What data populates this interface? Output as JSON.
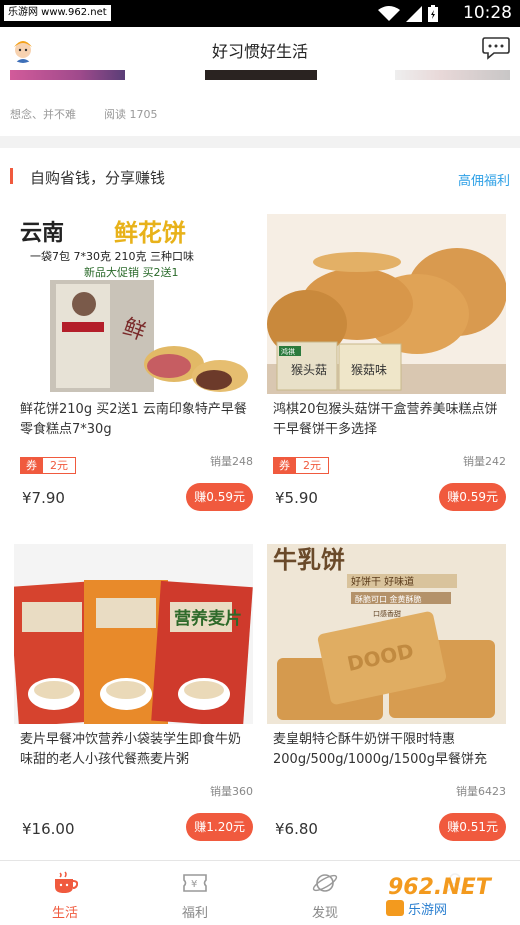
{
  "status_bar": {
    "watermark": "乐游网 www.962.net",
    "time": "10:28"
  },
  "header": {
    "title": "好习惯好生活",
    "avatar_icon": "cartoon-avatar",
    "chat_icon": "chat-bubble-icon"
  },
  "post": {
    "author": "想念、并不难",
    "reads": "阅读 1705"
  },
  "section": {
    "title": "自购省钱，分享赚钱",
    "link": "高佣福利"
  },
  "products": [
    {
      "name": "鲜花饼210g 买2送1 云南印象特产早餐零食糕点7*30g",
      "coupon_tag": "券",
      "coupon_amount": "2元",
      "sales": "销量248",
      "price": "¥7.90",
      "earn": "赚0.59元",
      "image_text": {
        "t1": "云南",
        "t2": "鲜花饼",
        "t3": "一袋7包  7*30克  210克 三种口味",
        "t4": "新品大促销  买2送1"
      }
    },
    {
      "name": "鸿棋20包猴头菇饼干盒营养美味糕点饼干早餐饼干多选择",
      "coupon_tag": "券",
      "coupon_amount": "2元",
      "sales": "销量242",
      "price": "¥5.90",
      "earn": "赚0.59元",
      "image_text": {
        "t1": "鸿祺",
        "t2": "猴头菇",
        "t3": "猴菇味"
      }
    },
    {
      "name": "麦片早餐冲饮营养小袋装学生即食牛奶味甜的老人小孩代餐燕麦片粥",
      "sales": "销量360",
      "price": "¥16.00",
      "earn": "赚1.20元",
      "image_text": {
        "t1": "营养麦片"
      }
    },
    {
      "name": "麦皇朝特仑酥牛奶饼干限时特惠200g/500g/1000g/1500g早餐饼充",
      "sales": "销量6423",
      "price": "¥6.80",
      "earn": "赚0.51元",
      "image_text": {
        "t1": "牛乳饼",
        "t2": "好饼干 好味道",
        "t3": "酥脆可口 金黄酥脆",
        "t4": "口感香甜"
      }
    }
  ],
  "tabs": [
    {
      "label": "生活",
      "icon": "cup-icon",
      "active": true
    },
    {
      "label": "福利",
      "icon": "yen-ticket-icon",
      "active": false
    },
    {
      "label": "发现",
      "icon": "planet-icon",
      "active": false
    },
    {
      "label": "",
      "icon": "user-icon",
      "active": false
    }
  ],
  "watermark_962": {
    "big": "962.NET",
    "small": "乐游网"
  },
  "colors": {
    "accent": "#f05a3e",
    "link": "#2ea0e6"
  }
}
